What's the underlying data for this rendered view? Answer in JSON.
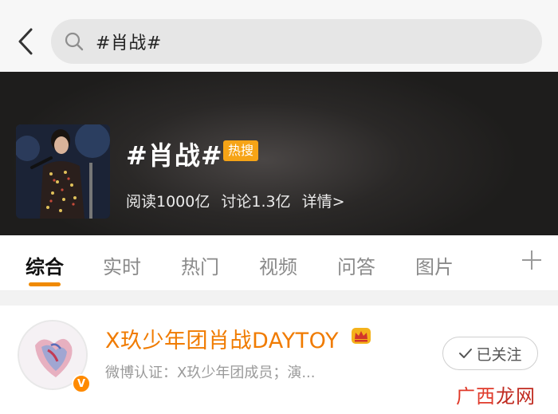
{
  "search": {
    "query": "#肖战#"
  },
  "topic": {
    "title": "#肖战#",
    "badge": "热搜",
    "reads": "阅读1000亿",
    "discussions": "讨论1.3亿",
    "detail_link": "详情>"
  },
  "tabs": [
    {
      "label": "综合",
      "active": true
    },
    {
      "label": "实时"
    },
    {
      "label": "热门"
    },
    {
      "label": "视频"
    },
    {
      "label": "问答"
    },
    {
      "label": "图片"
    }
  ],
  "account": {
    "name": "X玖少年团肖战DAYTOY",
    "verification": "微博认证：X玖少年团成员；演...",
    "follow_label": "已关注",
    "verified_badge": "V"
  },
  "watermark": {
    "part1": "广西",
    "part2": "龙网"
  },
  "colors": {
    "accent": "#f08a00",
    "badge": "#f6a416",
    "name": "#f07b00"
  },
  "icons": {
    "back": "chevron-left-icon",
    "search": "search-icon",
    "add_tab": "plus-icon",
    "check": "check-icon",
    "crown": "crown-icon"
  }
}
